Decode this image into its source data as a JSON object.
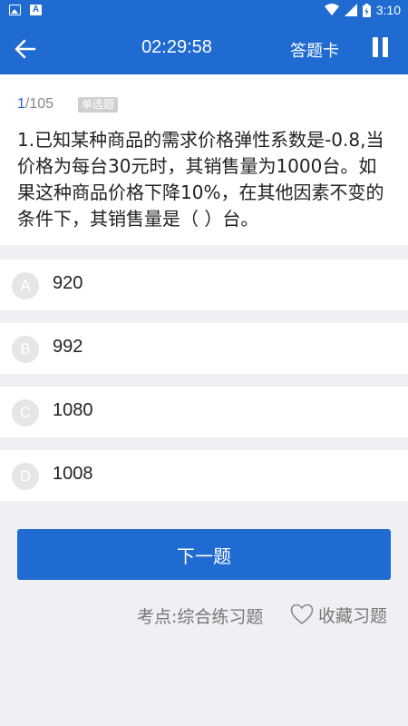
{
  "status_bar": {
    "time": "3:10"
  },
  "header": {
    "timer": "02:29:58",
    "answer_card_label": "答题卡"
  },
  "question": {
    "current": "1",
    "total": "/105",
    "type_label": "单选题",
    "text": "1.已知某种商品的需求价格弹性系数是-0.8,当价格为每台30元时，其销售量为1000台。如果这种商品价格下降10%，在其他因素不变的条件下，其销售量是（ ）台。"
  },
  "options": [
    {
      "letter": "A",
      "value": "920"
    },
    {
      "letter": "B",
      "value": "992"
    },
    {
      "letter": "C",
      "value": "1080"
    },
    {
      "letter": "D",
      "value": "1008"
    }
  ],
  "footer": {
    "next_label": "下一题",
    "kaodian_label": "考点:综合练习题",
    "favorite_label": "收藏习题"
  },
  "colors": {
    "primary": "#1f6bd1",
    "background": "#efeff4",
    "option_circle": "#e6e6e6"
  }
}
